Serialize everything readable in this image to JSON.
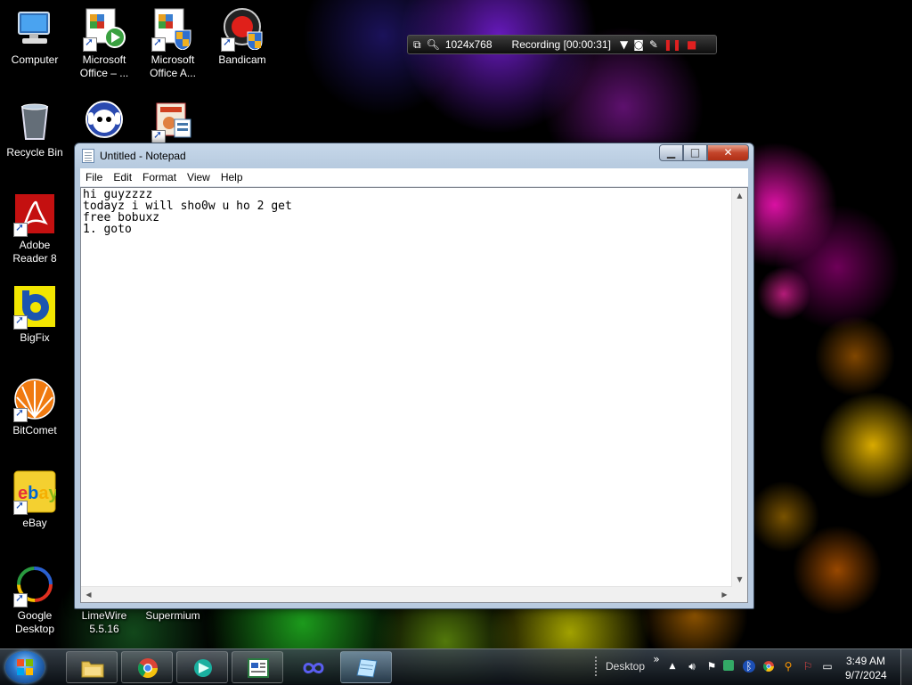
{
  "desktop_icons": [
    {
      "label": "Computer",
      "icon": "computer-icon"
    },
    {
      "label": "Microsoft Office – ...",
      "icon": "office-icon"
    },
    {
      "label": "Microsoft Office A...",
      "icon": "office-icon"
    },
    {
      "label": "Bandicam",
      "icon": "bandicam-icon"
    },
    {
      "label": "Recycle Bin",
      "icon": "recycle-bin-icon"
    },
    {
      "label": "",
      "icon": "napster-icon"
    },
    {
      "label": "",
      "icon": "presentation-icon"
    },
    {
      "label": "Adobe Reader 8",
      "icon": "adobe-reader-icon"
    },
    {
      "label": "BigFix",
      "icon": "bigfix-icon"
    },
    {
      "label": "BitComet",
      "icon": "bitcomet-icon"
    },
    {
      "label": "eBay",
      "icon": "ebay-icon"
    },
    {
      "label": "Google Desktop",
      "icon": "google-desktop-icon"
    },
    {
      "label": "LimeWire 5.5.16",
      "icon": "limewire-icon"
    },
    {
      "label": "Supermium",
      "icon": "supermium-icon"
    }
  ],
  "recording_bar": {
    "resolution": "1024x768",
    "status": "Recording [00:00:31]"
  },
  "notepad": {
    "title": "Untitled - Notepad",
    "menu": [
      "File",
      "Edit",
      "Format",
      "View",
      "Help"
    ],
    "text": "hi guyzzzz\ntodayz i will sho0w u ho 2 get\nfree bobuxz\n1. goto"
  },
  "taskbar": {
    "desktop_label": "Desktop",
    "time": "3:49 AM",
    "date": "9/7/2024"
  }
}
